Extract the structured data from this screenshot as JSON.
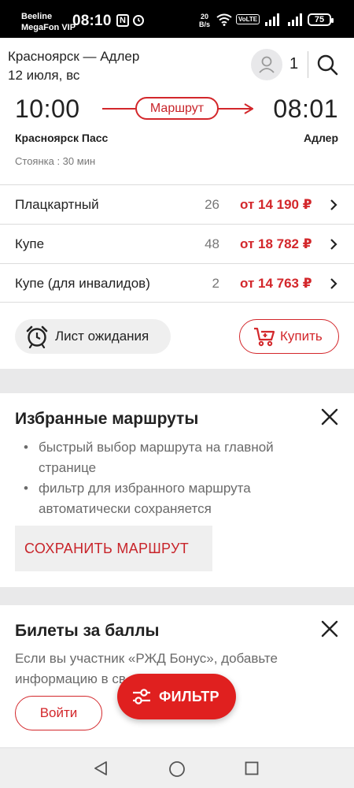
{
  "status_bar": {
    "carrier1": "Beeline",
    "carrier2": "MegaFon VIP",
    "time": "08:10",
    "nfc": "N",
    "net_speed_value": "20",
    "net_speed_unit": "B/s",
    "volte": "VoLTE",
    "battery": "75"
  },
  "header": {
    "route": "Красноярск — Адлер",
    "date": "12 июля, вс",
    "passengers": "1"
  },
  "train": {
    "departure_time": "10:00",
    "arrival_time": "08:01",
    "route_label": "Маршрут",
    "departure_station": "Красноярск Пасс",
    "arrival_station": "Адлер",
    "stop_info": "Стоянка : 30 мин",
    "classes": [
      {
        "name": "Плацкартный",
        "seats": "26",
        "price": "от 14 190 ₽"
      },
      {
        "name": "Купе",
        "seats": "48",
        "price": "от 18 782 ₽"
      },
      {
        "name": "Купе (для инвалидов)",
        "seats": "2",
        "price": "от 14 763 ₽"
      }
    ],
    "waitlist_label": "Лист ожидания",
    "buy_label": "Купить"
  },
  "favorites": {
    "title": "Избранные маршруты",
    "bullets": [
      "быстрый выбор маршрута на главной странице",
      "фильтр для избранного маршрута автоматически сохраняется"
    ],
    "save_label": "СОХРАНИТЬ МАРШРУТ"
  },
  "bonus": {
    "title": "Билеты за баллы",
    "text": "Если вы участник «РЖД Бонус», добавьте информацию в св",
    "login_label": "Войти"
  },
  "filter_label": "ФИЛЬТР",
  "colors": {
    "accent": "#d3272b",
    "fab": "#e0201f",
    "background": "#e9e9ea"
  }
}
